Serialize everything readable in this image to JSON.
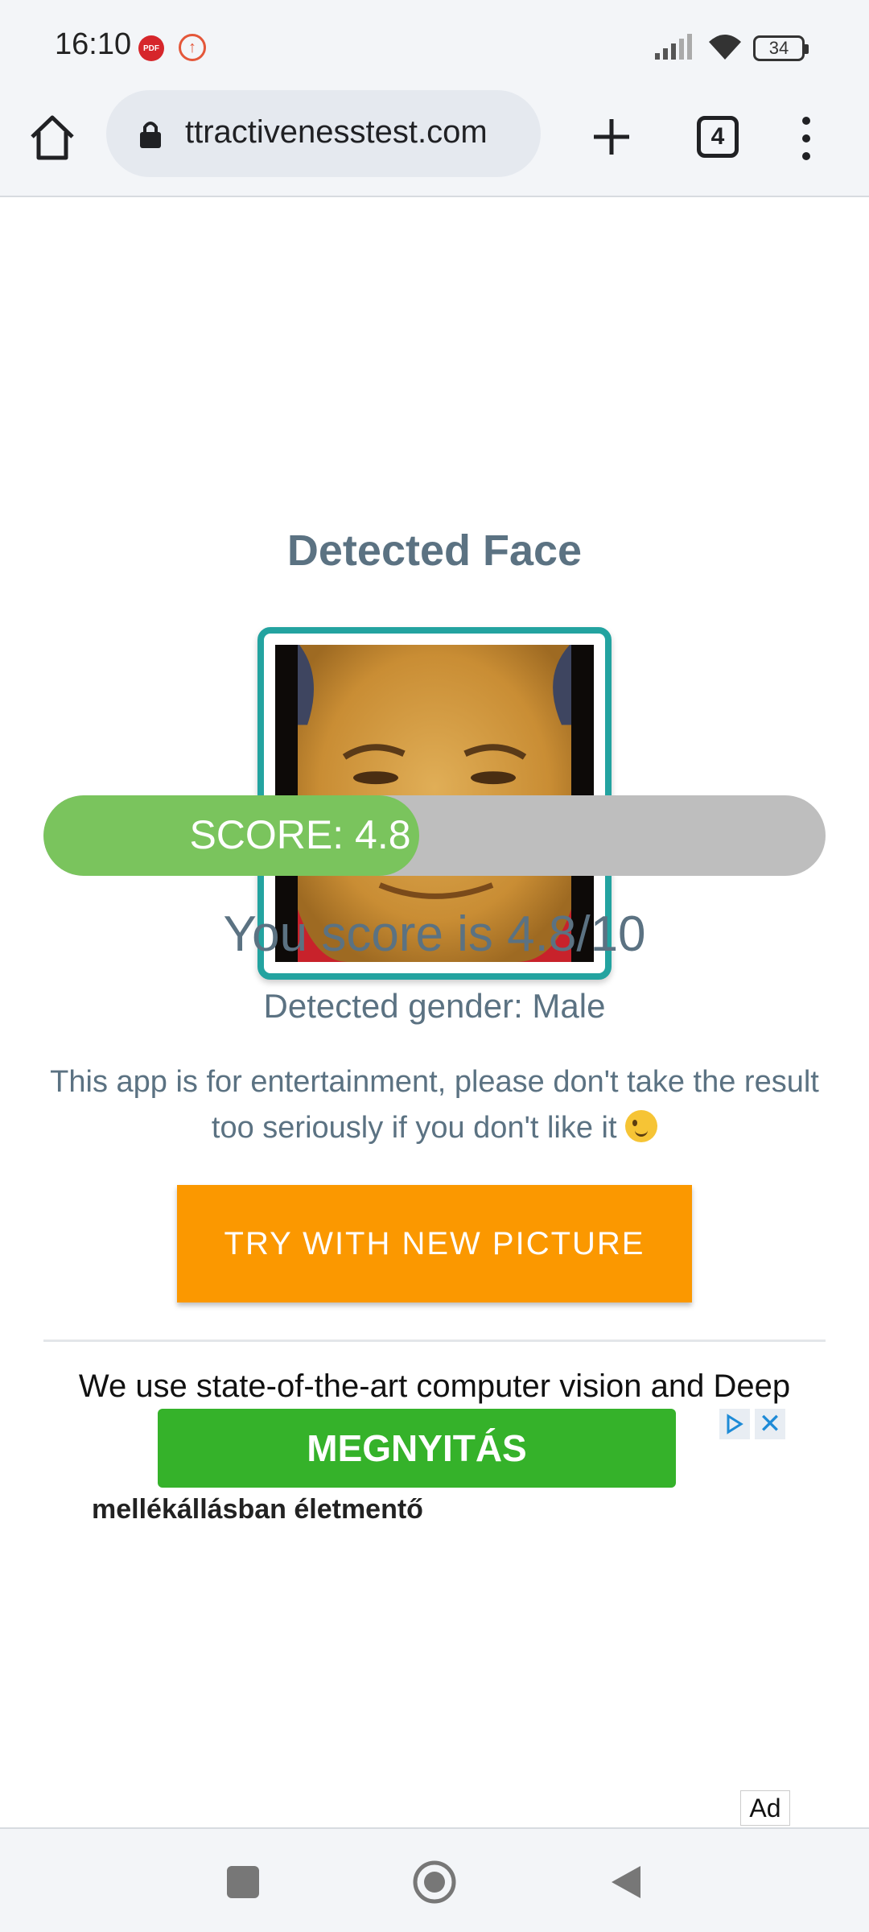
{
  "status_bar": {
    "time": "16:10",
    "pdf_badge": "PDF",
    "battery": "34",
    "icons": [
      "pdf-icon",
      "upload-icon",
      "signal-icon",
      "wifi-icon",
      "battery-icon"
    ]
  },
  "browser": {
    "url": "ttractivenesstest.com",
    "tab_count": "4",
    "icons": [
      "home-icon",
      "lock-icon",
      "plus-icon",
      "tabs-icon",
      "more-vert-icon"
    ]
  },
  "result": {
    "title": "Detected Face",
    "score_label": "SCORE: 4.8",
    "score_fraction": 0.48,
    "score_text": "You score is 4.8/10",
    "gender_text": "Detected gender: Male",
    "disclaimer": "This app is for entertainment, please don't take the result too seriously if you don't like it",
    "try_button": "TRY WITH NEW PICTURE",
    "body_text": "We use state-of-the-art computer vision and Deep"
  },
  "ad": {
    "open_button": "MEGNYITÁS",
    "headline": "mellékállásban életmentő",
    "close_symbol": "✕",
    "badge": "Ad"
  },
  "colors": {
    "accent_teal": "#23a3a0",
    "score_green": "#7ac45d",
    "button_orange": "#fb9800",
    "ad_green": "#35b22a",
    "text_slate": "#5b7282"
  }
}
